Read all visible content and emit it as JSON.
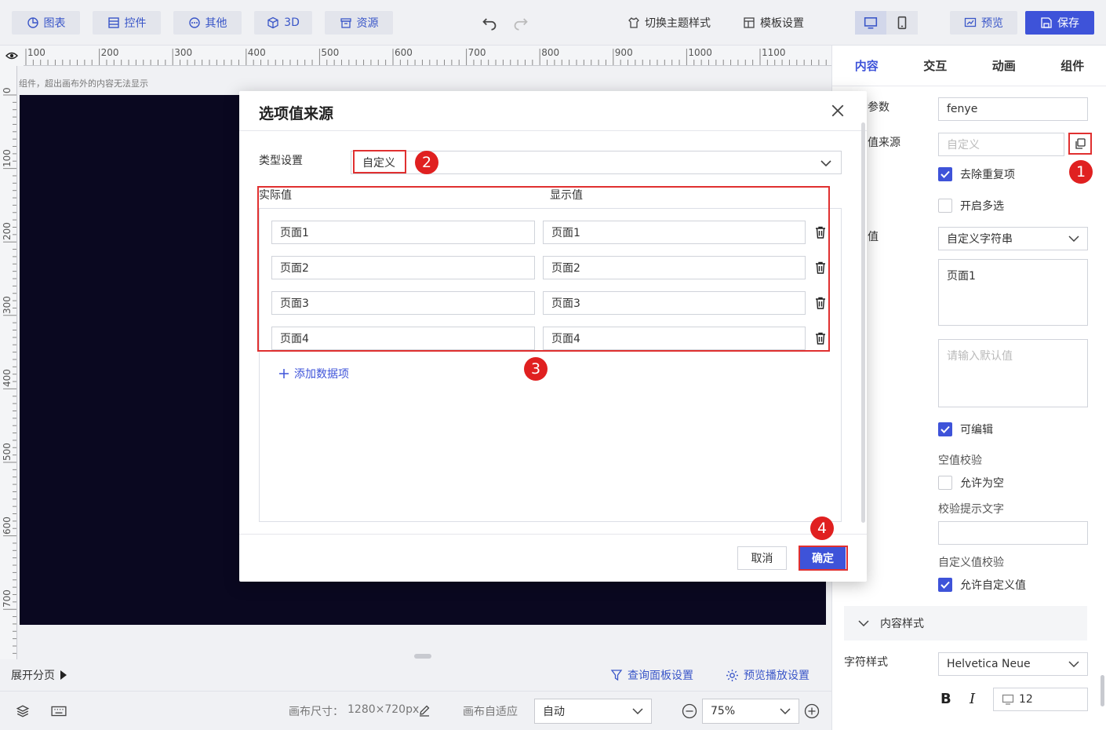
{
  "toolbar": {
    "tabs": [
      {
        "label": "图表",
        "icon": "chart-pie-icon"
      },
      {
        "label": "控件",
        "icon": "widget-icon"
      },
      {
        "label": "其他",
        "icon": "more-circle-icon"
      },
      {
        "label": "3D",
        "icon": "cube-icon"
      },
      {
        "label": "资源",
        "icon": "archive-icon"
      }
    ],
    "theme_label": "切换主题样式",
    "template_label": "模板设置",
    "preview_label": "预览",
    "save_label": "保存"
  },
  "ruler": {
    "top_marks": [
      "100",
      "200",
      "300",
      "400",
      "500",
      "600",
      "700",
      "800",
      "900",
      "1000",
      "1100"
    ],
    "left_marks": [
      "0",
      "100",
      "200",
      "300",
      "400",
      "500",
      "600",
      "700"
    ]
  },
  "canvas": {
    "note": "组件，超出画布外的内容无法显示",
    "background": "#0a0820"
  },
  "bottom": {
    "expand_label": "展开分页",
    "query_panel_label": "查询面板设置",
    "preview_play_label": "预览播放设置",
    "canvas_size_label": "画布尺寸：",
    "canvas_size_value": "1280×720px",
    "canvas_fit_label": "画布自适应",
    "canvas_fit_value": "自动",
    "zoom_value": "75%"
  },
  "right_panel": {
    "tabs": [
      "内容",
      "交互",
      "动画",
      "组件"
    ],
    "active_tab": "内容",
    "param_label": "参数",
    "param_value": "fenye",
    "source_label": "值来源",
    "source_placeholder": "自定义",
    "dedupe_label": "去除重复项",
    "multi_label": "开启多选",
    "default_label": "值",
    "default_type": "自定义字符串",
    "default_value": "页面1",
    "default_placeholder": "请输入默认值",
    "editable_label": "可编辑",
    "null_check_label": "空值校验",
    "allow_null_label": "允许为空",
    "check_tip_label": "校验提示文字",
    "custom_check_label": "自定义值校验",
    "allow_custom_label": "允许自定义值",
    "content_style_label": "内容样式",
    "font_style_label": "字符样式",
    "font_value": "Helvetica Neue",
    "bold_label": "B",
    "italic_label": "I",
    "font_size": "12"
  },
  "modal": {
    "title": "选项值来源",
    "type_label": "类型设置",
    "type_value": "自定义",
    "col_actual": "实际值",
    "col_display": "显示值",
    "rows": [
      {
        "actual": "页面1",
        "display": "页面1"
      },
      {
        "actual": "页面2",
        "display": "页面2"
      },
      {
        "actual": "页面3",
        "display": "页面3"
      },
      {
        "actual": "页面4",
        "display": "页面4"
      }
    ],
    "add_label": "添加数据项",
    "cancel_label": "取消",
    "ok_label": "确定"
  },
  "badges": [
    "1",
    "2",
    "3",
    "4"
  ],
  "colors": {
    "accent": "#3e53d9",
    "highlight": "#e02020"
  }
}
